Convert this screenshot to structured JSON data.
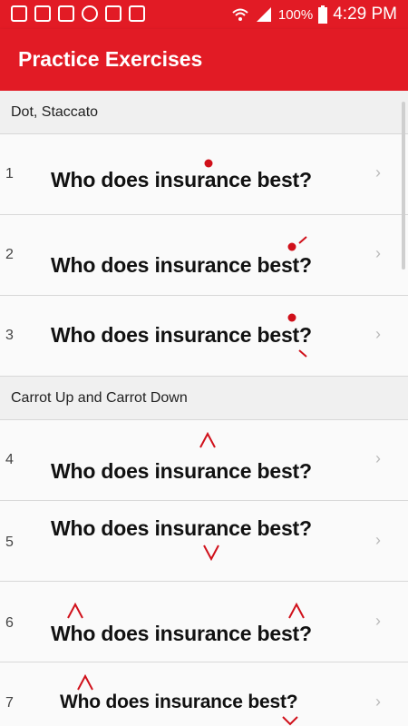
{
  "status_bar": {
    "battery_percent": "100%",
    "time": "4:29 PM",
    "icons": [
      "image-icon",
      "copy-icon",
      "gmail-icon",
      "shield-icon",
      "block-icon",
      "clipboard-check-icon",
      "wifi-icon",
      "signal-icon",
      "battery-icon"
    ]
  },
  "app_bar": {
    "title": "Practice Exercises"
  },
  "sections": [
    {
      "header": "Dot, Staccato",
      "rows": [
        {
          "number": "1",
          "sentence": "Who does insurance best?"
        },
        {
          "number": "2",
          "sentence": "Who does insurance best?"
        },
        {
          "number": "3",
          "sentence": "Who does insurance best?"
        }
      ]
    },
    {
      "header": "Carrot Up and Carrot Down",
      "rows": [
        {
          "number": "4",
          "sentence": "Who does insurance best?"
        },
        {
          "number": "5",
          "sentence": "Who does insurance best?"
        },
        {
          "number": "6",
          "sentence": "Who does insurance best?"
        },
        {
          "number": "7",
          "sentence": "Who does insurance best?"
        }
      ]
    }
  ],
  "chevron": "›",
  "colors": {
    "accent": "#e21b25",
    "mark": "#d0101a"
  }
}
